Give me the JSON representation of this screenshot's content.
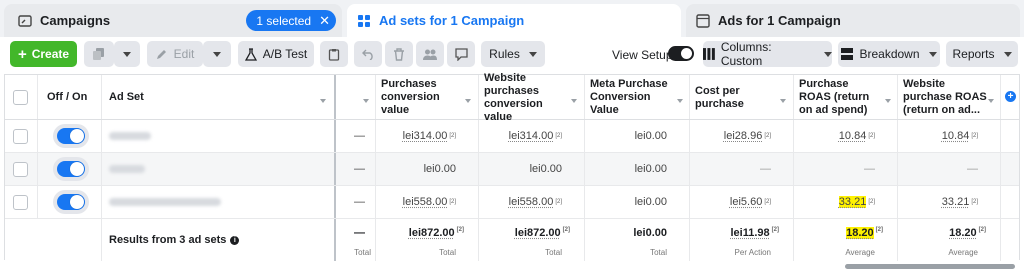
{
  "tabs": {
    "campaigns": "Campaigns",
    "selected_pill": "1 selected",
    "adsets": "Ad sets for 1 Campaign",
    "ads": "Ads for 1 Campaign"
  },
  "toolbar": {
    "create": "Create",
    "edit": "Edit",
    "ab_test": "A/B Test",
    "rules": "Rules",
    "view_setup": "View Setup",
    "columns": "Columns: Custom",
    "breakdown": "Breakdown",
    "reports": "Reports"
  },
  "headers": {
    "off_on": "Off / On",
    "ad_set": "Ad Set",
    "purchases_value": "Purchases conversion value",
    "website_purchases_value": "Website purchases conversion value",
    "meta_purchase_value": "Meta Purchase Conversion Value",
    "cost_per_purchase": "Cost per purchase",
    "purchase_roas": "Purchase ROAS (return on ad spend)",
    "website_purchase_roas": "Website purchase ROAS (return on ad..."
  },
  "rows": [
    {
      "dash": "—",
      "purchases_value": "lei314.00",
      "website_value": "lei314.00",
      "meta_value": "lei0.00",
      "cost": "lei28.96",
      "roas": "10.84",
      "web_roas": "10.84"
    },
    {
      "dash": "—",
      "purchases_value": "lei0.00",
      "website_value": "lei0.00",
      "meta_value": "lei0.00",
      "cost": "—",
      "roas": "—",
      "web_roas": "—"
    },
    {
      "dash": "—",
      "purchases_value": "lei558.00",
      "website_value": "lei558.00",
      "meta_value": "lei0.00",
      "cost": "lei5.60",
      "roas": "33.21",
      "web_roas": "33.21"
    }
  ],
  "totals": {
    "label": "Results from 3 ad sets",
    "dash": "—",
    "dash_sub": "Total",
    "purchases_value": "lei872.00",
    "purchases_sub": "Total",
    "website_value": "lei872.00",
    "website_sub": "Total",
    "meta_value": "lei0.00",
    "meta_sub": "Total",
    "cost": "lei11.98",
    "cost_sub": "Per Action",
    "roas": "18.20",
    "roas_sub": "Average",
    "web_roas": "18.20",
    "web_roas_sub": "Average"
  },
  "sup_mark": "[2]",
  "colors": {
    "accent": "#1877f2",
    "create": "#42b72a",
    "highlight": "#fff200"
  }
}
